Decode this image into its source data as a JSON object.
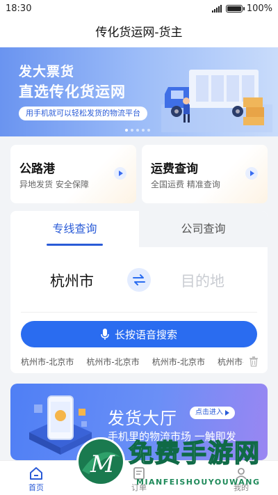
{
  "status": {
    "time": "18:30",
    "battery": "100%"
  },
  "title": "传化货运网-货主",
  "banner": {
    "line1": "发大票货",
    "line2": "直选传化货运网",
    "tagline": "用手机就可以轻松发货的物流平台",
    "slide_count": 5,
    "active_slide": 0
  },
  "quick_cards": [
    {
      "title": "公路港",
      "subtitle": "异地发货 安全保障"
    },
    {
      "title": "运费查询",
      "subtitle": "全国运费 精准查询"
    }
  ],
  "search": {
    "tabs": [
      "专线查询",
      "公司查询"
    ],
    "active_tab": 0,
    "from_city": "杭州市",
    "to_placeholder": "目的地",
    "voice_label": "长按语音搜索",
    "history": [
      "杭州市-北京市",
      "杭州市-北京市",
      "杭州市-北京市",
      "杭州市-北京市"
    ]
  },
  "hall": {
    "title": "发货大厅",
    "cta": "点击进入",
    "subtitle": "手机里的物流市场 一触即发"
  },
  "bottom_nav": [
    {
      "label": "首页",
      "icon": "home-icon",
      "active": true
    },
    {
      "label": "订单",
      "icon": "order-icon",
      "active": false
    },
    {
      "label": "我的",
      "icon": "profile-icon",
      "active": false
    }
  ],
  "watermark": {
    "text": "免费手游网",
    "sub": "MIANFEISHOUYOUWANG"
  },
  "colors": {
    "accent": "#2a6cf0",
    "brand_text": "#2a5bd7"
  }
}
